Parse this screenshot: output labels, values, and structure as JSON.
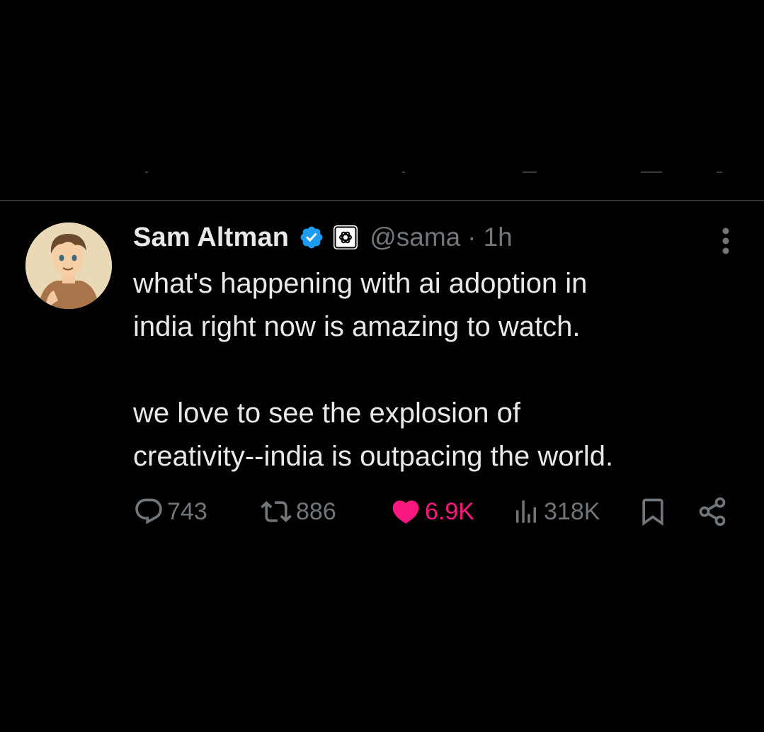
{
  "tweet": {
    "author_name": "Sam Altman",
    "handle": "@sama",
    "separator": "·",
    "time": "1h",
    "text_lines": [
      "what's happening with ai adoption in",
      "india right now is amazing to watch.",
      "we love to see the explosion of",
      "creativity--india is outpacing the world."
    ],
    "stats": {
      "replies": "743",
      "reposts": "886",
      "likes": "6.9K",
      "views": "318K"
    }
  },
  "colors": {
    "background": "#000000",
    "text": "#e7e9ea",
    "muted": "#71767b",
    "verified": "#1d9bf0",
    "like": "#f91880",
    "divider": "#2f3336"
  },
  "icons": [
    "verified-badge-icon",
    "openai-affiliation-icon",
    "more-icon",
    "reply-icon",
    "repost-icon",
    "like-icon",
    "views-icon",
    "bookmark-icon",
    "share-icon"
  ]
}
